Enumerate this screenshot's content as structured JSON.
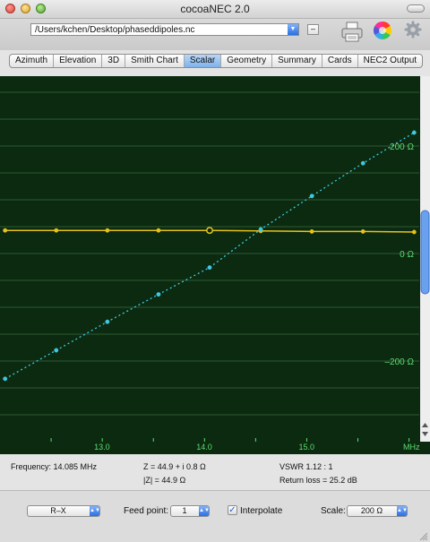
{
  "window": {
    "title": "cocoaNEC 2.0"
  },
  "toolbar": {
    "path": "/Users/kchen/Desktop/phaseddipoles.nc",
    "minus_label": "–"
  },
  "tabs": [
    {
      "label": "Azimuth",
      "active": false
    },
    {
      "label": "Elevation",
      "active": false
    },
    {
      "label": "3D",
      "active": false
    },
    {
      "label": "Smith Chart",
      "active": false
    },
    {
      "label": "Scalar",
      "active": true
    },
    {
      "label": "Geometry",
      "active": false
    },
    {
      "label": "Summary",
      "active": false
    },
    {
      "label": "Cards",
      "active": false
    },
    {
      "label": "NEC2 Output",
      "active": false
    }
  ],
  "colors": {
    "plot_bg": "#0b2a10",
    "grid": "#2f5a35",
    "label": "#5fdc72",
    "resistance": "#e8c21a",
    "reactance": "#40c8e0"
  },
  "chart_data": {
    "type": "line",
    "x_unit": "MHz",
    "x_ticks": [
      "13.0",
      "14.0",
      "15.0"
    ],
    "y_labels": [
      "200 Ω",
      "0 Ω",
      "–200 Ω"
    ],
    "xlim": [
      12.0,
      16.1
    ],
    "ylim": [
      -350,
      330
    ],
    "series": [
      {
        "style": "solid-yellow",
        "x": [
          12.05,
          12.55,
          13.05,
          13.55,
          14.05,
          14.55,
          15.05,
          15.55,
          16.05
        ],
        "y": [
          43,
          43,
          43,
          43,
          43,
          42,
          41,
          41,
          40
        ],
        "highlight_index": 4
      },
      {
        "style": "dotted-cyan",
        "x": [
          12.05,
          12.55,
          13.05,
          13.55,
          14.05,
          14.55,
          15.05,
          15.55,
          16.05
        ],
        "y": [
          -233,
          -180,
          -127,
          -76,
          -26,
          45,
          107,
          168,
          225
        ]
      }
    ]
  },
  "readout": {
    "frequency": "Frequency: 14.085 MHz",
    "impedance": "Z = 44.9 + i 0.8 Ω",
    "magnitude": "|Z| = 44.9 Ω",
    "vswr": "VSWR 1.12 : 1",
    "return_loss": "Return loss = 25.2 dB"
  },
  "controls": {
    "plot_type": "R–X",
    "feed_label": "Feed point:",
    "feed_value": "1",
    "interpolate_label": "Interpolate",
    "interpolate_checked": true,
    "scale_label": "Scale:",
    "scale_value": "200 Ω"
  }
}
